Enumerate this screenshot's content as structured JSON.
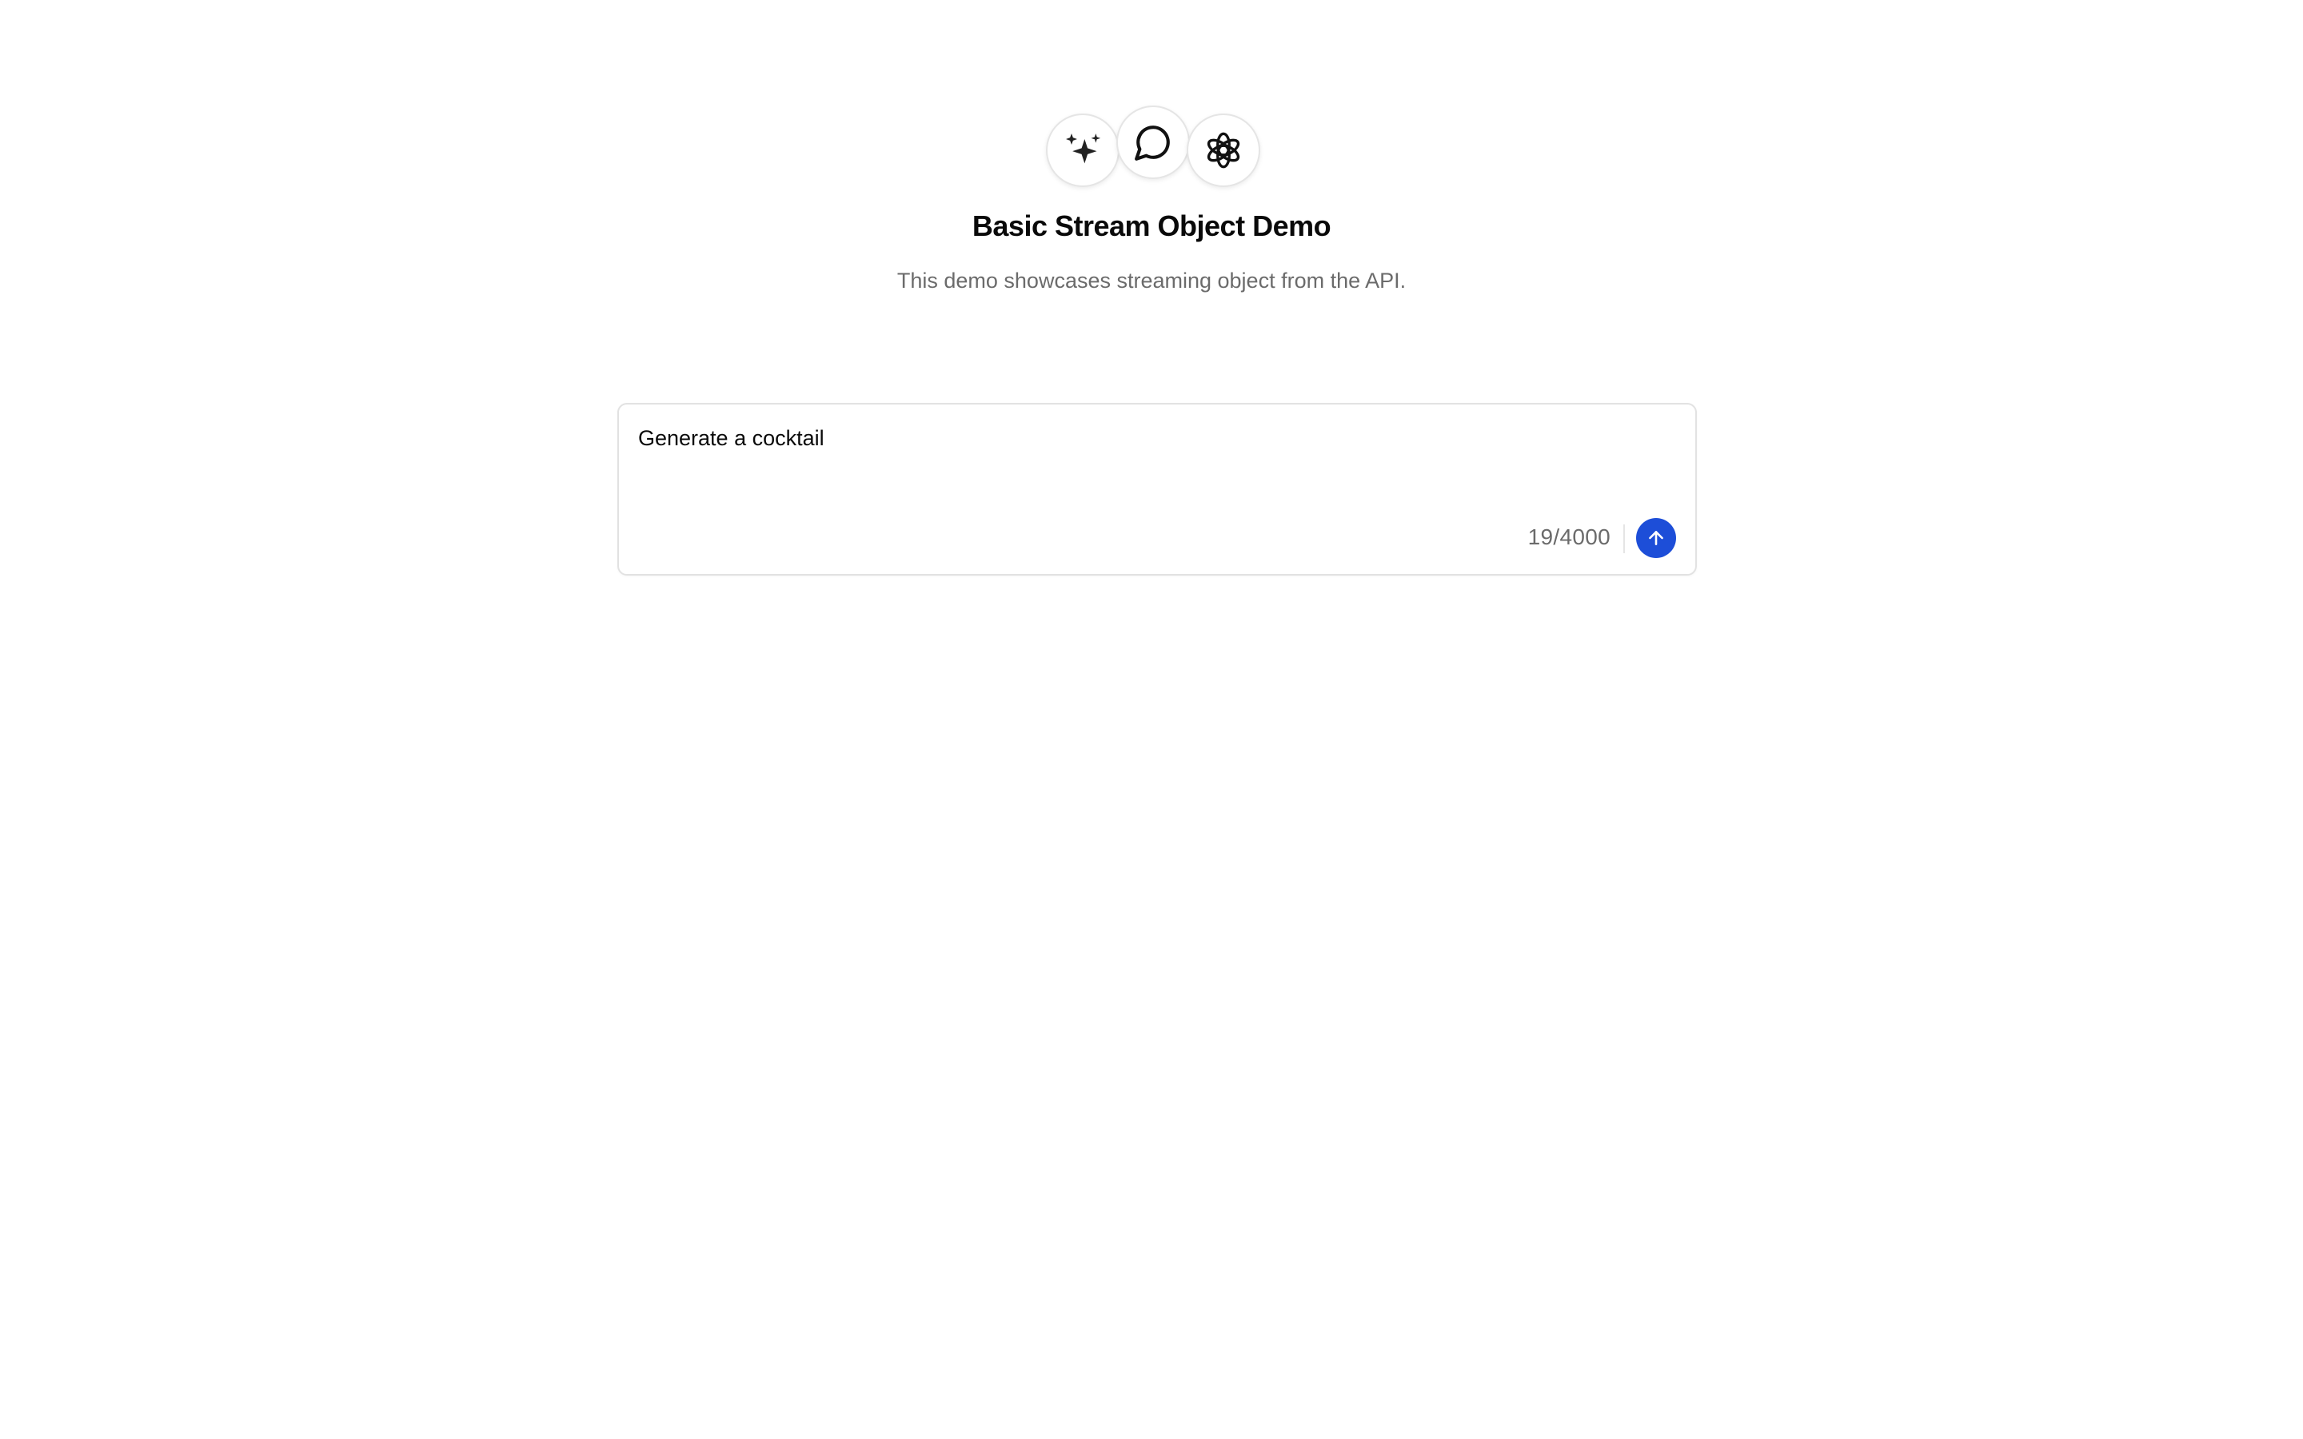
{
  "header": {
    "icons": [
      "sparkles-icon",
      "chat-bubble-icon",
      "openai-logo-icon"
    ],
    "title": "Basic Stream Object Demo",
    "subtitle": "This demo showcases streaming object from the API."
  },
  "prompt": {
    "value": "Generate a cocktail",
    "counter": "19/4000",
    "send_icon": "arrow-up-icon"
  },
  "colors": {
    "accent": "#1d4ed8",
    "muted_text": "#6b6b6b",
    "border": "#e2e2e2"
  }
}
